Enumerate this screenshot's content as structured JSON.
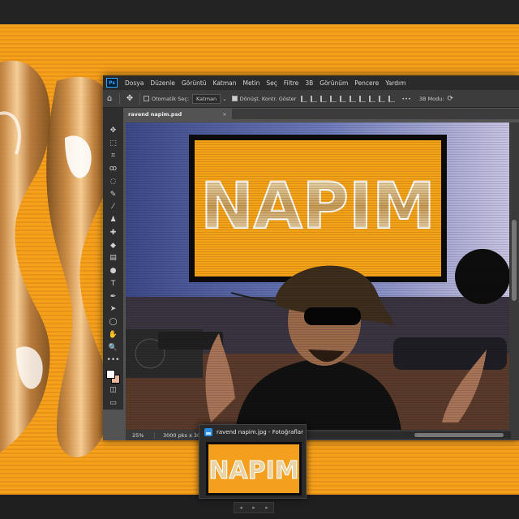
{
  "colors": {
    "accent_orange": "#f5a21a",
    "ps_blue": "#31a8ff",
    "canvas_bg": "#535353"
  },
  "app": {
    "logo": "Ps"
  },
  "menu": [
    "Dosya",
    "Düzenle",
    "Görüntü",
    "Katman",
    "Metin",
    "Seç",
    "Filtre",
    "3B",
    "Görünüm",
    "Pencere",
    "Yardım"
  ],
  "options": {
    "auto_select_label": "Otomatik Seç:",
    "auto_select_value": "Katman",
    "transform_label": "Dönüşt. Kontr. Göster",
    "more": "•••",
    "mode_3d_label": "3B Modu:"
  },
  "document": {
    "tab_title": "ravend napim.psd",
    "close": "×"
  },
  "status": {
    "zoom": "25%",
    "doc_size": "3000 pks x 3000"
  },
  "photos": {
    "title": "ravend napim.jpg - Fotoğraflar"
  },
  "canvas_text": {
    "sign": "NAPIM"
  },
  "tools": [
    "move-tool",
    "marquee-tool",
    "crop-tool",
    "lasso-tool",
    "quick-select-tool",
    "eyedropper-tool",
    "brush-tool",
    "stamp-tool",
    "healing-tool",
    "eraser-tool",
    "gradient-tool",
    "dodge-tool",
    "type-tool",
    "pen-tool",
    "path-select-tool",
    "shape-tool",
    "hand-tool",
    "zoom-tool",
    "more-tools"
  ],
  "tool_glyphs": [
    "✥",
    "⬚",
    "⌗",
    "ꝏ",
    "◌",
    "✎",
    "⁄",
    "♟",
    "✚",
    "◆",
    "▤",
    "●",
    "T",
    "✒",
    "➤",
    "◯",
    "✋",
    "🔍",
    "•••"
  ]
}
